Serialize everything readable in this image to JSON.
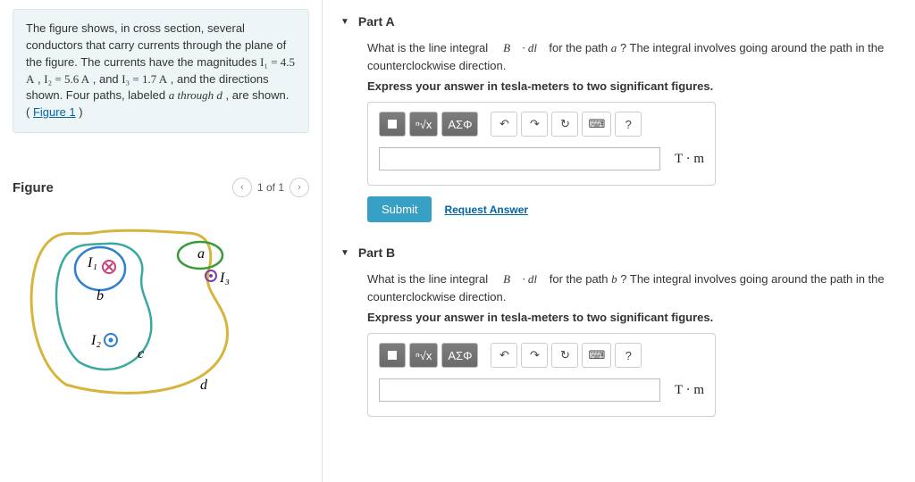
{
  "problem": {
    "text_parts": {
      "p1": "The figure shows, in cross section, several conductors that carry currents through the plane of the figure. The currents have the magnitudes ",
      "i1": "I₁ = 4.5 A",
      "sep1": ", ",
      "i2": "I₂ = 5.6 A",
      "sep2": ", and ",
      "i3": "I₃ = 1.7 A",
      "p2": ", and the directions shown. Four paths, labeled ",
      "paths": "a through d",
      "p3": ", are shown. (",
      "figlink": "Figure 1",
      "p4": ")"
    }
  },
  "figure": {
    "title": "Figure",
    "nav": {
      "page": "1 of 1"
    },
    "labels": {
      "I1": "I₁",
      "I2": "I₂",
      "I3": "I₃",
      "a": "a",
      "b": "b",
      "c": "c",
      "d": "d"
    }
  },
  "parts": {
    "a": {
      "header": "Part A",
      "question_prefix": "What is the line integral ",
      "integral": "∮ B · dl",
      "question_mid": " for the path ",
      "pathname": "a",
      "question_suffix": "? The integral involves going around the path in the counterclockwise direction.",
      "instr": "Express your answer in tesla-meters to two significant figures.",
      "unit": "T · m",
      "submit": "Submit",
      "request": "Request Answer"
    },
    "b": {
      "header": "Part B",
      "question_prefix": "What is the line integral ",
      "integral": "∮ B · dl",
      "question_mid": " for the path ",
      "pathname": "b",
      "question_suffix": "? The integral involves going around the path in the counterclockwise direction.",
      "instr": "Express your answer in tesla-meters to two significant figures.",
      "unit": "T · m"
    }
  },
  "toolbar": {
    "greek": "ΑΣΦ",
    "help": "?"
  }
}
